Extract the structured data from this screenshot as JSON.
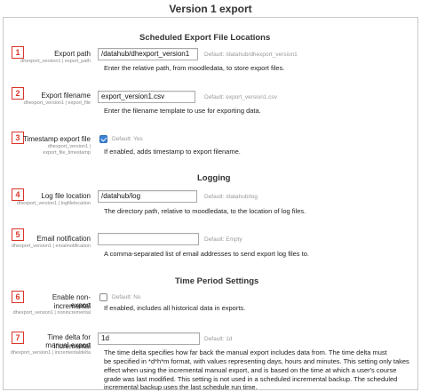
{
  "page_title": "Version 1 export",
  "sections": {
    "scheduled": "Scheduled Export File Locations",
    "logging": "Logging",
    "time_period": "Time Period Settings"
  },
  "callouts": [
    "1",
    "2",
    "3",
    "4",
    "5",
    "6",
    "7"
  ],
  "settings": {
    "export_path": {
      "label": "Export path",
      "key": "dhexport_version1 | export_path",
      "value": "/datahub/dhexport_version1",
      "default": "Default: /datahub/dhexport_version1",
      "description": "Enter the relative path, from moodledata, to store export files."
    },
    "export_filename": {
      "label": "Export filename",
      "key": "dhexport_version1 | export_file",
      "value": "export_version1.csv",
      "default": "Default: export_version1.csv",
      "description": "Enter the filename template to use for exporting data."
    },
    "timestamp": {
      "label": "Timestamp export file",
      "key_line1": "dhexport_version1 |",
      "key_line2": "export_file_timestamp",
      "checked": true,
      "default": "Default: Yes",
      "description": "If enabled, adds timestamp to export filename."
    },
    "log_location": {
      "label": "Log file location",
      "key": "dhexport_version1 | logfilelocation",
      "value": "/datahub/log",
      "default": "Default: /datahub/log",
      "description": "The directory path, relative to moodledata, to the location of log files."
    },
    "email_notification": {
      "label": "Email notification",
      "key": "dhexport_version1 | emailnotification",
      "value": "",
      "default": "Default: Empty",
      "description": "A comma-separated list of email addresses to send export log files to."
    },
    "noncremental": {
      "label_line1": "Enable non-incremental",
      "label_line2": "export",
      "key": "dhexport_version1 | nonincremental",
      "checked": false,
      "default": "Default: No",
      "description": "If enabled, includes all historical data in exports."
    },
    "time_delta": {
      "label_line1": "Time delta for incremental",
      "label_line2": "manual export",
      "key": "dhexport_version1 | incrementaldelta",
      "value": "1d",
      "default": "Default: 1d",
      "description_lines": [
        "The time delta specifies how far back the manual export includes data from. The time delta must",
        "be specified in *d*h*m format, with values representing days, hours and minutes. This setting only takes",
        "effect when using the incremental manual export, and is based on the time at which a user's course",
        "grade was last modified. This setting is not used in a scheduled incremental backup. The scheduled",
        "incremental backup uses the last schedule run time."
      ]
    }
  }
}
